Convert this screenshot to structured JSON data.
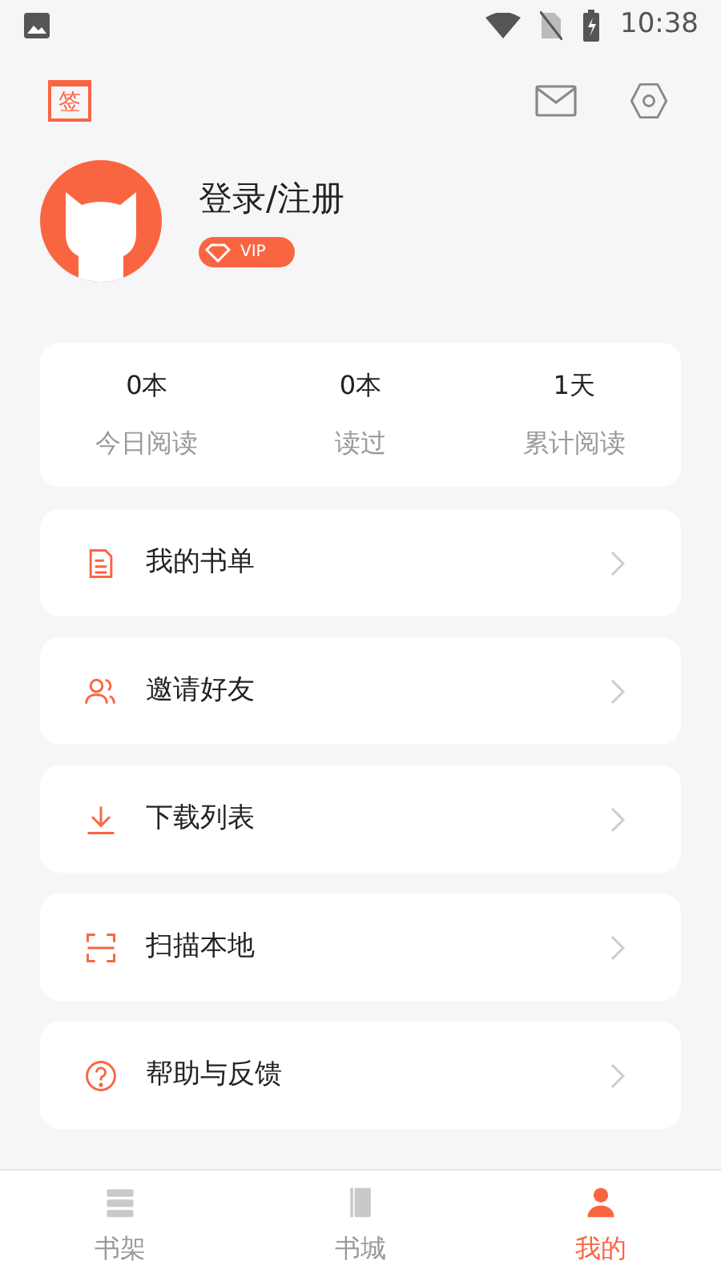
{
  "status_bar": {
    "time": "10:38"
  },
  "header": {
    "checkin_label": "签"
  },
  "profile": {
    "name": "登录/注册",
    "badge": "VIP"
  },
  "stats": [
    {
      "value": "0本",
      "label": "今日阅读"
    },
    {
      "value": "0本",
      "label": "读过"
    },
    {
      "value": "1天",
      "label": "累计阅读"
    }
  ],
  "menu": [
    {
      "kind": "booklist",
      "label": "我的书单"
    },
    {
      "kind": "invite",
      "label": "邀请好友"
    },
    {
      "kind": "download",
      "label": "下载列表"
    },
    {
      "kind": "scan",
      "label": "扫描本地"
    },
    {
      "kind": "help",
      "label": "帮助与反馈"
    }
  ],
  "tabs": [
    {
      "kind": "shelf",
      "label": "书架",
      "selected": false
    },
    {
      "kind": "store",
      "label": "书城",
      "selected": false
    },
    {
      "kind": "me",
      "label": "我的",
      "selected": true
    }
  ]
}
